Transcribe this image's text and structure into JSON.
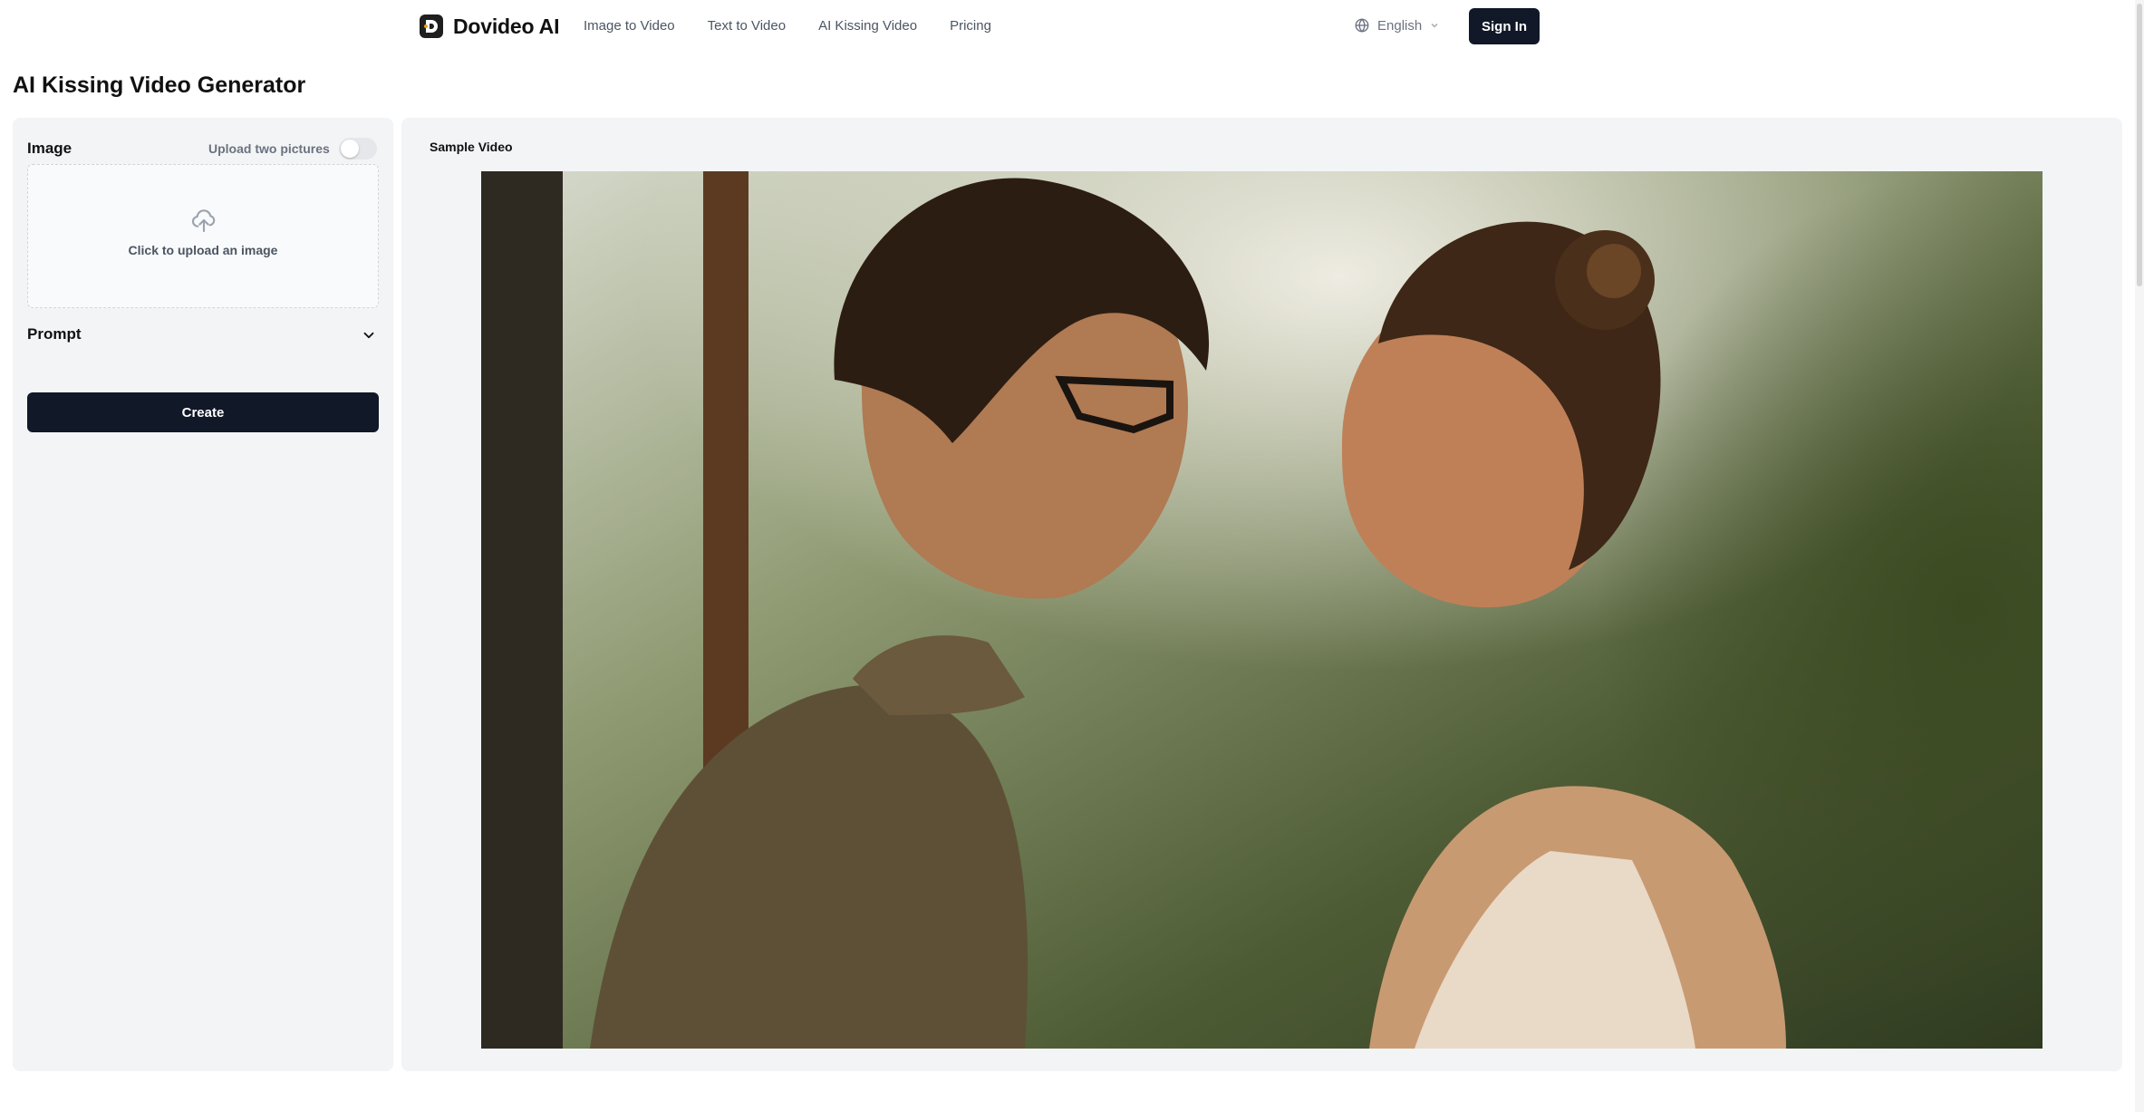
{
  "brand": {
    "name": "Dovideo AI"
  },
  "nav": {
    "items": [
      {
        "label": "Image to Video"
      },
      {
        "label": "Text to Video"
      },
      {
        "label": "AI Kissing Video"
      },
      {
        "label": "Pricing"
      }
    ]
  },
  "language": {
    "selected": "English",
    "icon": "globe-icon"
  },
  "auth": {
    "sign_in_label": "Sign In"
  },
  "page": {
    "title": "AI Kissing Video Generator"
  },
  "form": {
    "image_label": "Image",
    "two_pictures_label": "Upload two pictures",
    "two_pictures_enabled": false,
    "upload_text": "Click to upload an image",
    "upload_icon": "cloud-upload-icon",
    "prompt_label": "Prompt",
    "prompt_icon": "chevron-down-icon",
    "create_label": "Create"
  },
  "preview": {
    "label": "Sample Video"
  },
  "colors": {
    "primary_button": "#111827",
    "panel_bg": "#f3f4f6"
  }
}
